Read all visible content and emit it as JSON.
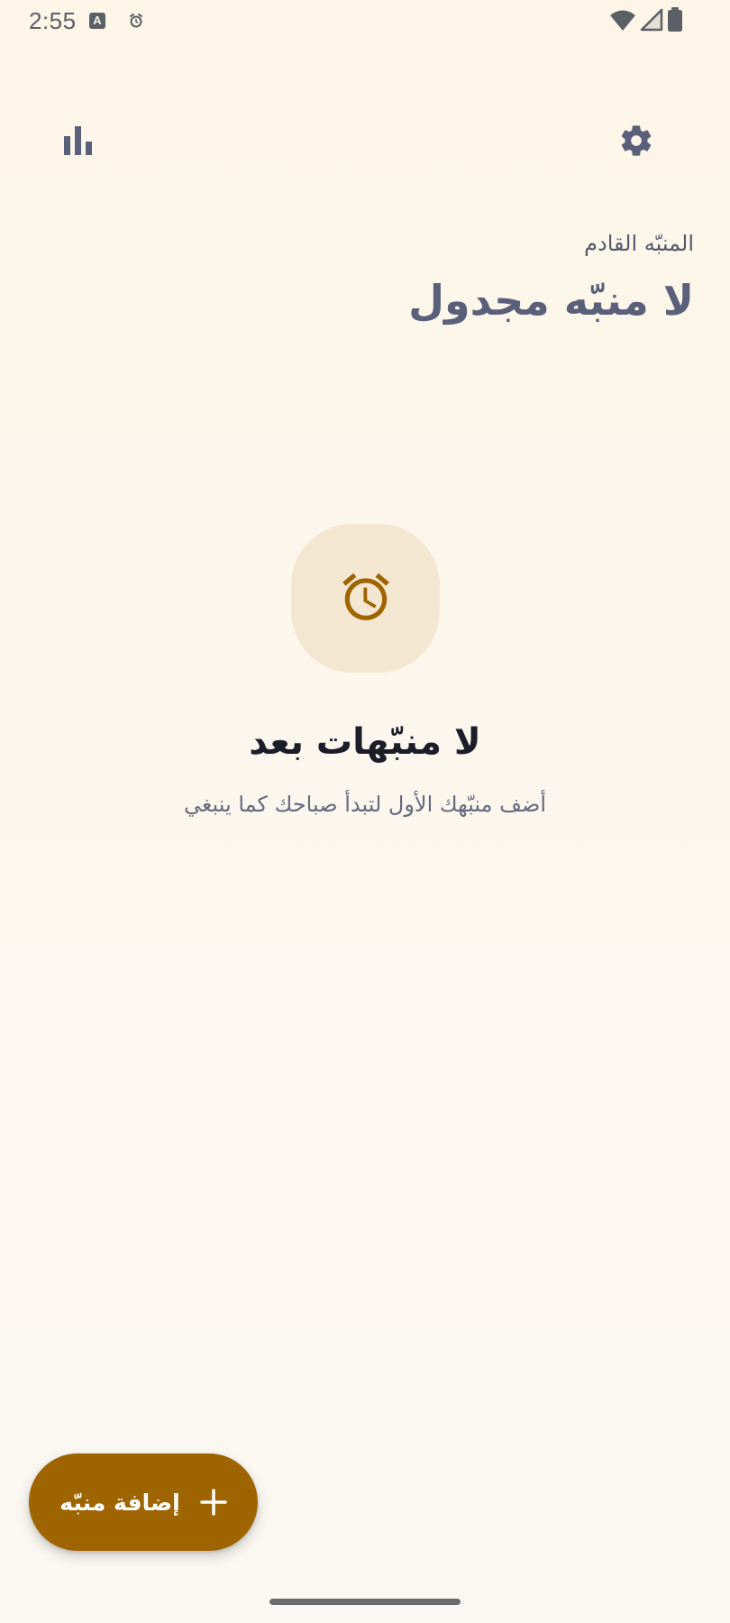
{
  "status_bar": {
    "time": "2:55",
    "a_icon_letter": "A",
    "icons": [
      "text-a-icon",
      "alarm-small-icon",
      "wifi-icon",
      "signal-icon",
      "battery-icon"
    ]
  },
  "toolbar": {
    "left_icon": "bar-chart-icon",
    "right_icon": "gear-icon"
  },
  "next_alarm": {
    "label": "المنبّه القادم",
    "value": "لا منبّه مجدول"
  },
  "empty_state": {
    "icon": "alarm-clock-icon",
    "title": "لا منبّهات بعد",
    "subtitle": "أضف منبّهك الأول لتبدأ صباحك كما ينبغي"
  },
  "fab": {
    "label": "إضافة منبّه",
    "icon": "plus-icon"
  },
  "colors": {
    "background": "#FDF5E8",
    "accent": "#9E6400",
    "icon_bg": "#F3E7D2",
    "toolbar_icon": "#5A607A",
    "title_text": "#1B1D29"
  }
}
